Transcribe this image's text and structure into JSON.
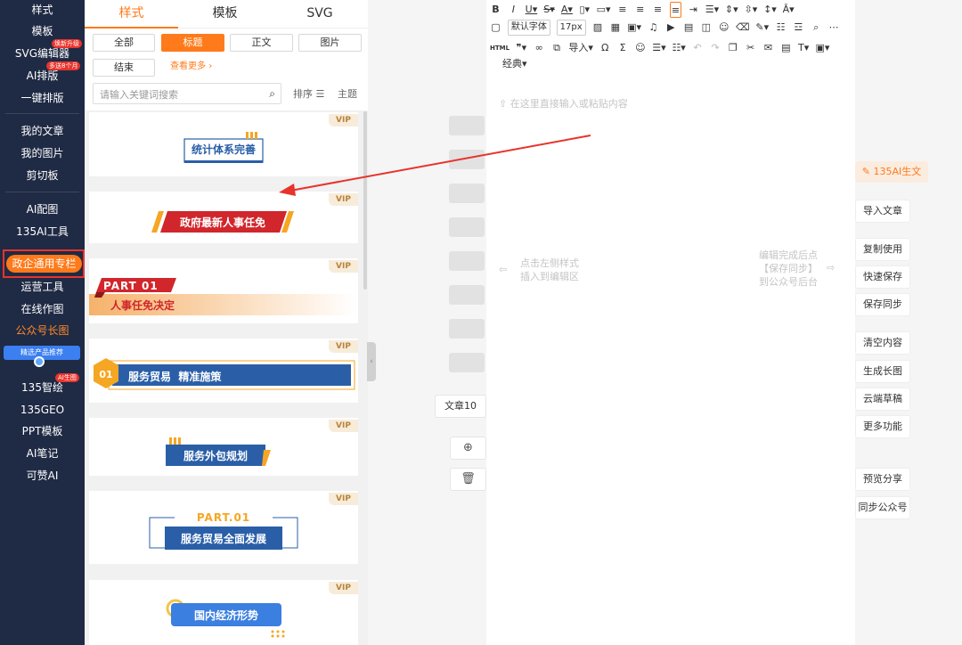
{
  "nav": {
    "items": [
      "样式",
      "模板",
      "SVG编辑器",
      "AI排版",
      "一键排版",
      "我的文章",
      "我的图片",
      "剪切板",
      "AI配图",
      "135AI工具",
      "政企通用专栏",
      "运营工具",
      "在线作图",
      "公众号长图",
      "135智绘",
      "135GEO",
      "PPT模板",
      "AI笔记",
      "可赞AI"
    ],
    "badges": [
      "焕新升级",
      "多送8个月",
      "AI生图"
    ],
    "promo": "精选产品推荐"
  },
  "panel": {
    "tabs": [
      "样式",
      "模板",
      "SVG"
    ],
    "chips": [
      "全部",
      "标题",
      "正文",
      "图片",
      "结束"
    ],
    "more": "查看更多",
    "search_placeholder": "请输入关键词搜索",
    "sort": "排序",
    "theme": "主题",
    "vip": "VIP",
    "cards": [
      {
        "title": "统计体系完善"
      },
      {
        "title": "政府最新人事任免"
      },
      {
        "tag": "PART 01",
        "title": "人事任免决定"
      },
      {
        "num": "01",
        "title": "服务贸易  精准施策"
      },
      {
        "title": "服务外包规划"
      },
      {
        "tag": "PART.01",
        "title": "服务贸易全面发展"
      },
      {
        "title": "国内经济形势"
      }
    ]
  },
  "mid": {
    "article": "文章10",
    "add_icon": "⊕",
    "delete_icon": "🗑"
  },
  "editor": {
    "font": "默认字体",
    "size": "17px",
    "import": "导入",
    "classic": "经典",
    "html": "HTML",
    "placeholder": "在这里直接输入或粘贴内容",
    "left_hint": [
      "点击左侧样式",
      "插入到编辑区"
    ],
    "right_hint": [
      "编辑完成后点",
      "【保存同步】",
      "到公众号后台"
    ]
  },
  "right": {
    "ai": "135AI生文",
    "buttons": [
      "导入文章",
      "复制使用",
      "快速保存",
      "保存同步",
      "清空内容",
      "生成长图",
      "云端草稿",
      "更多功能",
      "预览分享",
      "同步公众号"
    ]
  },
  "colors": {
    "accent": "#ff7a1a",
    "nav": "#1f2a44",
    "red": "#e8332c",
    "blue": "#2a5fa8"
  }
}
